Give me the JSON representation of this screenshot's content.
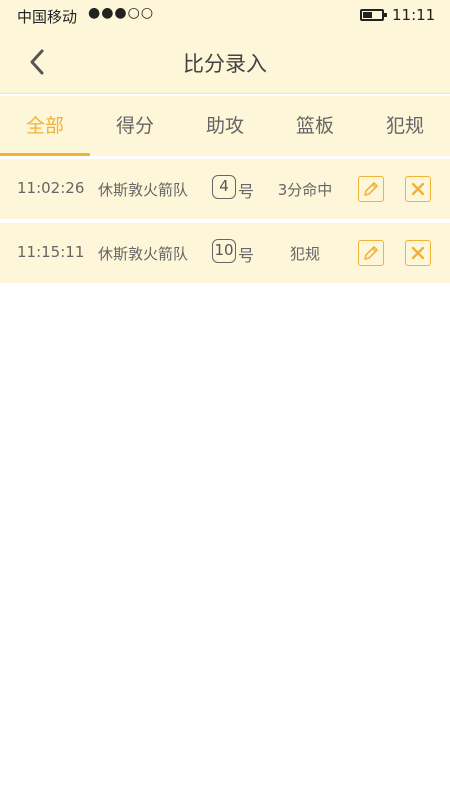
{
  "statusbar": {
    "carrier": "中国移动",
    "signal": "●●●○○",
    "time": "11:11"
  },
  "navbar": {
    "title": "比分录入"
  },
  "tabs": [
    {
      "label": "全部",
      "active": true
    },
    {
      "label": "得分",
      "active": false
    },
    {
      "label": "助攻",
      "active": false
    },
    {
      "label": "篮板",
      "active": false
    },
    {
      "label": "犯规",
      "active": false
    }
  ],
  "records": [
    {
      "time": "11:02:26",
      "team": "休斯敦火箭队",
      "number": "4",
      "suffix": "号",
      "event": "3分命中"
    },
    {
      "time": "11:15:11",
      "team": "休斯敦火箭队",
      "number": "10",
      "suffix": "号",
      "event": "犯规"
    }
  ],
  "colors": {
    "accent": "#f1b23a",
    "background": "#fdf6d8"
  }
}
